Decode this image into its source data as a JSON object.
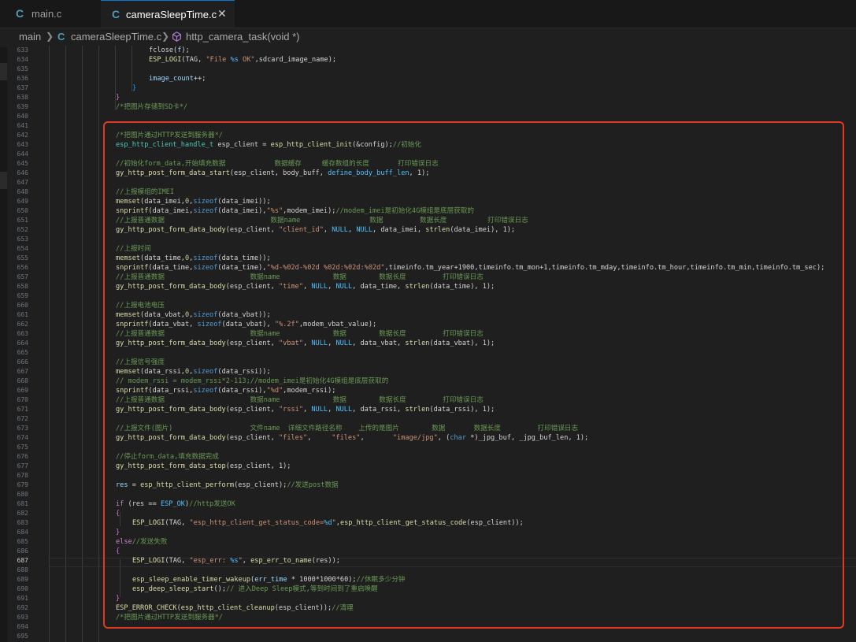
{
  "tabs": [
    {
      "icon": "C",
      "label": "main.c"
    },
    {
      "icon": "C",
      "label": "cameraSleepTime.c",
      "close": "✕"
    }
  ],
  "breadcrumb": {
    "folder": "main",
    "file_icon": "C",
    "file": "cameraSleepTime.c",
    "symbol": "http_camera_task(void *)"
  },
  "editor": {
    "current_line": 687,
    "line_numbers": [
      633,
      634,
      635,
      636,
      637,
      638,
      639,
      640,
      641,
      642,
      643,
      644,
      645,
      646,
      647,
      648,
      649,
      650,
      651,
      652,
      653,
      654,
      655,
      656,
      657,
      658,
      659,
      660,
      661,
      662,
      663,
      664,
      665,
      666,
      667,
      668,
      669,
      670,
      671,
      672,
      673,
      674,
      675,
      676,
      677,
      678,
      679,
      680,
      681,
      682,
      683,
      684,
      685,
      686,
      687,
      688,
      689,
      690,
      691,
      692,
      693,
      694,
      695
    ],
    "lines": [
      [
        [
          "p",
          "fclose("
        ],
        [
          "v",
          "f"
        ],
        [
          "p",
          ");"
        ]
      ],
      [
        [
          "f",
          "ESP_LOGI"
        ],
        [
          "p",
          "(TAG, "
        ],
        [
          "s",
          "\"File "
        ],
        [
          "m",
          "%s"
        ],
        [
          "s",
          " OK\""
        ],
        [
          "p",
          ",sdcard_image_name);"
        ]
      ],
      [],
      [
        [
          "v",
          "image_count"
        ],
        [
          "p",
          "++;"
        ]
      ],
      [
        [
          "bl",
          "}"
        ]
      ],
      [
        [
          "pk",
          "}"
        ]
      ],
      [
        [
          "c",
          "/*把图片存储到SD卡*/"
        ]
      ],
      [],
      [],
      [
        [
          "c",
          "/*把图片通过HTTP发送到服务器*/"
        ]
      ],
      [
        [
          "t",
          "esp_http_client_handle_t"
        ],
        [
          "p",
          " esp_client = "
        ],
        [
          "f",
          "esp_http_client_init"
        ],
        [
          "p",
          "(&config);"
        ],
        [
          "c",
          "//初始化"
        ]
      ],
      [],
      [
        [
          "c",
          "//初始化form_data,开始填充数据            数据缓存     缓存数组的长度       打印错误日志"
        ]
      ],
      [
        [
          "f",
          "gy_http_post_form_data_start"
        ],
        [
          "p",
          "(esp_client, body_buff, "
        ],
        [
          "m",
          "define_body_buff_len"
        ],
        [
          "p",
          ", 1);"
        ]
      ],
      [],
      [
        [
          "c",
          "//上报模组的IMEI"
        ]
      ],
      [
        [
          "f",
          "memset"
        ],
        [
          "p",
          "(data_imei,"
        ],
        [
          "n",
          "0"
        ],
        [
          "p",
          ","
        ],
        [
          "b",
          "sizeof"
        ],
        [
          "p",
          "(data_imei));"
        ]
      ],
      [
        [
          "f",
          "snprintf"
        ],
        [
          "p",
          "(data_imei,"
        ],
        [
          "b",
          "sizeof"
        ],
        [
          "p",
          "(data_imei),"
        ],
        [
          "s",
          "\"%s\""
        ],
        [
          "p",
          ",modem_imei);"
        ],
        [
          "c",
          "//modem_imei是初始化4G模组是底层获取的"
        ]
      ],
      [
        [
          "c",
          "//上报普通数据                          数据name                 数据         数据长度          打印错误日志"
        ]
      ],
      [
        [
          "f",
          "gy_http_post_form_data_body"
        ],
        [
          "p",
          "(esp_client, "
        ],
        [
          "s",
          "\"client_id\""
        ],
        [
          "p",
          ", "
        ],
        [
          "m",
          "NULL"
        ],
        [
          "p",
          ", "
        ],
        [
          "m",
          "NULL"
        ],
        [
          "p",
          ", data_imei, "
        ],
        [
          "f",
          "strlen"
        ],
        [
          "p",
          "(data_imei), 1);"
        ]
      ],
      [],
      [
        [
          "c",
          "//上报时间"
        ]
      ],
      [
        [
          "f",
          "memset"
        ],
        [
          "p",
          "(data_time,"
        ],
        [
          "n",
          "0"
        ],
        [
          "p",
          ","
        ],
        [
          "b",
          "sizeof"
        ],
        [
          "p",
          "(data_time));"
        ]
      ],
      [
        [
          "f",
          "snprintf"
        ],
        [
          "p",
          "(data_time,"
        ],
        [
          "b",
          "sizeof"
        ],
        [
          "p",
          "(data_time),"
        ],
        [
          "s",
          "\"%d-%02d-%02d %02d:%02d:%02d\""
        ],
        [
          "p",
          ",timeinfo.tm_year+1900,timeinfo.tm_mon+1,timeinfo.tm_mday,timeinfo.tm_hour,timeinfo.tm_min,timeinfo.tm_sec);"
        ]
      ],
      [
        [
          "c",
          "//上报普通数据                     数据name             数据        数据长度         打印错误日志"
        ]
      ],
      [
        [
          "f",
          "gy_http_post_form_data_body"
        ],
        [
          "p",
          "(esp_client, "
        ],
        [
          "s",
          "\"time\""
        ],
        [
          "p",
          ", "
        ],
        [
          "m",
          "NULL"
        ],
        [
          "p",
          ", "
        ],
        [
          "m",
          "NULL"
        ],
        [
          "p",
          ", data_time, "
        ],
        [
          "f",
          "strlen"
        ],
        [
          "p",
          "(data_time), 1);"
        ]
      ],
      [],
      [
        [
          "c",
          "//上报电池电压"
        ]
      ],
      [
        [
          "f",
          "memset"
        ],
        [
          "p",
          "(data_vbat,"
        ],
        [
          "n",
          "0"
        ],
        [
          "p",
          ","
        ],
        [
          "b",
          "sizeof"
        ],
        [
          "p",
          "(data_vbat));"
        ]
      ],
      [
        [
          "f",
          "snprintf"
        ],
        [
          "p",
          "(data_vbat, "
        ],
        [
          "b",
          "sizeof"
        ],
        [
          "p",
          "(data_vbat), "
        ],
        [
          "s",
          "\"%.2f\""
        ],
        [
          "p",
          ",modem_vbat_value);"
        ]
      ],
      [
        [
          "c",
          "//上报普通数据                     数据name             数据        数据长度         打印错误日志"
        ]
      ],
      [
        [
          "f",
          "gy_http_post_form_data_body"
        ],
        [
          "p",
          "(esp_client, "
        ],
        [
          "s",
          "\"vbat\""
        ],
        [
          "p",
          ", "
        ],
        [
          "m",
          "NULL"
        ],
        [
          "p",
          ", "
        ],
        [
          "m",
          "NULL"
        ],
        [
          "p",
          ", data_vbat, "
        ],
        [
          "f",
          "strlen"
        ],
        [
          "p",
          "(data_vbat), 1);"
        ]
      ],
      [],
      [
        [
          "c",
          "//上报信号强度"
        ]
      ],
      [
        [
          "f",
          "memset"
        ],
        [
          "p",
          "(data_rssi,"
        ],
        [
          "n",
          "0"
        ],
        [
          "p",
          ","
        ],
        [
          "b",
          "sizeof"
        ],
        [
          "p",
          "(data_rssi));"
        ]
      ],
      [
        [
          "c",
          "// modem_rssi = modem_rssi*2-113;//modem_imei是初始化4G模组是底层获取的"
        ]
      ],
      [
        [
          "f",
          "snprintf"
        ],
        [
          "p",
          "(data_rssi,"
        ],
        [
          "b",
          "sizeof"
        ],
        [
          "p",
          "(data_rssi),"
        ],
        [
          "s",
          "\"%d\""
        ],
        [
          "p",
          ",modem_rssi);"
        ]
      ],
      [
        [
          "c",
          "//上报普通数据                     数据name             数据        数据长度         打印错误日志"
        ]
      ],
      [
        [
          "f",
          "gy_http_post_form_data_body"
        ],
        [
          "p",
          "(esp_client, "
        ],
        [
          "s",
          "\"rssi\""
        ],
        [
          "p",
          ", "
        ],
        [
          "m",
          "NULL"
        ],
        [
          "p",
          ", "
        ],
        [
          "m",
          "NULL"
        ],
        [
          "p",
          ", data_rssi, "
        ],
        [
          "f",
          "strlen"
        ],
        [
          "p",
          "(data_rssi), 1);"
        ]
      ],
      [],
      [
        [
          "c",
          "//上报文件(图片)                   文件name  详细文件路径名称    上传的是图片        数据       数据长度         打印错误日志"
        ]
      ],
      [
        [
          "f",
          "gy_http_post_form_data_body"
        ],
        [
          "p",
          "(esp_client, "
        ],
        [
          "s",
          "\"files\""
        ],
        [
          "p",
          ",     "
        ],
        [
          "s",
          "\"files\""
        ],
        [
          "p",
          ",       "
        ],
        [
          "s",
          "\"image/jpg\""
        ],
        [
          "p",
          ", ("
        ],
        [
          "b",
          "char"
        ],
        [
          "p",
          " *)_jpg_buf, _jpg_buf_len, 1);"
        ]
      ],
      [],
      [
        [
          "c",
          "//停止form_data,填充数据完成"
        ]
      ],
      [
        [
          "f",
          "gy_http_post_form_data_stop"
        ],
        [
          "p",
          "(esp_client, 1);"
        ]
      ],
      [],
      [
        [
          "v",
          "res"
        ],
        [
          "p",
          " = "
        ],
        [
          "f",
          "esp_http_client_perform"
        ],
        [
          "p",
          "(esp_client);"
        ],
        [
          "c",
          "//发送post数据"
        ]
      ],
      [],
      [
        [
          "k",
          "if"
        ],
        [
          "p",
          " (res == "
        ],
        [
          "m",
          "ESP_OK"
        ],
        [
          "p",
          ")"
        ],
        [
          "c",
          "//http发送OK"
        ]
      ],
      [
        [
          "pk",
          "{"
        ]
      ],
      [
        [
          "f",
          "ESP_LOGI"
        ],
        [
          "p",
          "(TAG, "
        ],
        [
          "s",
          "\"esp_http_client_get_status_code="
        ],
        [
          "m",
          "%d"
        ],
        [
          "s",
          "\""
        ],
        [
          "p",
          ","
        ],
        [
          "f",
          "esp_http_client_get_status_code"
        ],
        [
          "p",
          "(esp_client));"
        ]
      ],
      [
        [
          "pk",
          "}"
        ]
      ],
      [
        [
          "k",
          "else"
        ],
        [
          "c",
          "//发送失败"
        ]
      ],
      [
        [
          "pk",
          "{"
        ]
      ],
      [
        [
          "f",
          "ESP_LOGI"
        ],
        [
          "p",
          "(TAG, "
        ],
        [
          "s",
          "\"esp_err: "
        ],
        [
          "m",
          "%s"
        ],
        [
          "s",
          "\""
        ],
        [
          "p",
          ", "
        ],
        [
          "f",
          "esp_err_to_name"
        ],
        [
          "p",
          "(res));"
        ]
      ],
      [],
      [
        [
          "f",
          "esp_sleep_enable_timer_wakeup"
        ],
        [
          "p",
          "("
        ],
        [
          "v",
          "err_time"
        ],
        [
          "p",
          " * 1000*1000*60);"
        ],
        [
          "c",
          "//休眠多少分钟"
        ]
      ],
      [
        [
          "f",
          "esp_deep_sleep_start"
        ],
        [
          "p",
          "();"
        ],
        [
          "c",
          "// 进入Deep Sleep模式,等到时间到了重启唤醒"
        ]
      ],
      [
        [
          "pk",
          "}"
        ]
      ],
      [
        [
          "f",
          "ESP_ERROR_CHECK"
        ],
        [
          "p",
          "("
        ],
        [
          "f",
          "esp_http_client_cleanup"
        ],
        [
          "p",
          "(esp_client));"
        ],
        [
          "c",
          "//清理"
        ]
      ],
      [
        [
          "c",
          "/*把图片通过HTTP发送到服务器*/"
        ]
      ],
      [],
      []
    ]
  },
  "colors": {
    "highlight_box": "#e03a26",
    "accent": "#0078d4"
  }
}
